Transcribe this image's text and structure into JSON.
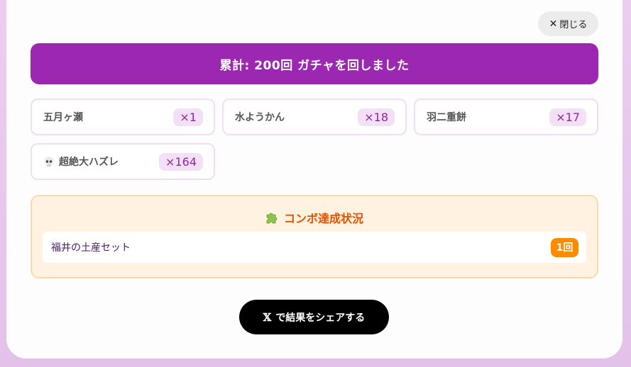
{
  "close_button": {
    "icon": "close-icon",
    "label": "閉じる"
  },
  "total_banner": {
    "text": "累計: 200回 ガチャを回しました"
  },
  "items": [
    {
      "name": "五月ヶ瀬",
      "count": "×1"
    },
    {
      "name": "水ようかん",
      "count": "×18"
    },
    {
      "name": "羽二重餅",
      "count": "×17"
    },
    {
      "name": "超絶大ハズレ",
      "count": "×164",
      "icon": "skull-icon"
    }
  ],
  "combo": {
    "title": "コンボ達成状況",
    "icon": "puzzle-piece-icon",
    "rows": [
      {
        "name": "福井の土産セット",
        "badge": "1回"
      }
    ]
  },
  "share_button": {
    "icon": "x-logo-icon",
    "label": "で結果をシェアする"
  },
  "colors": {
    "banner": "#9c27b0",
    "item_count_bg": "#f3e0f6",
    "combo_title": "#e65100",
    "combo_badge": "#fb8c00",
    "share_button": "#000000"
  }
}
